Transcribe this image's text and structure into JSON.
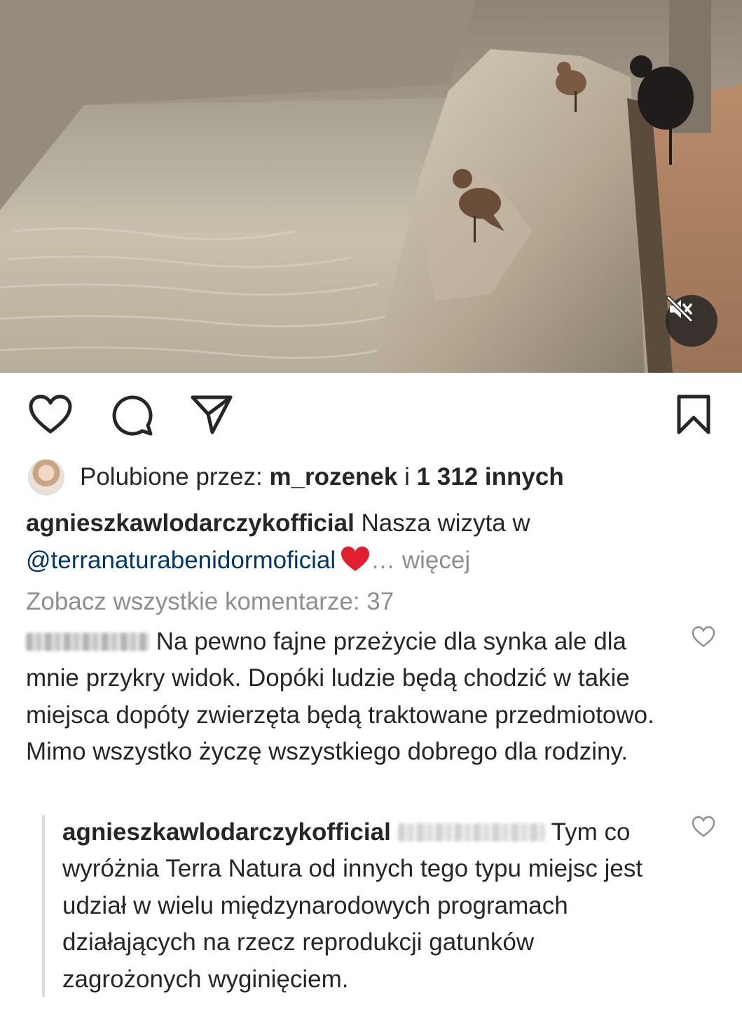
{
  "post": {
    "likes": {
      "prefix": "Polubione przez:",
      "user": "m_rozenek",
      "joiner": "i",
      "others": "1 312 innych"
    },
    "caption": {
      "username": "agnieszkawlodarczykofficial",
      "text": "Nasza wizyta w",
      "mention": "@terranaturabenidormoficial",
      "emoji": "heart-emoji",
      "more": "… więcej"
    },
    "view_all_comments": "Zobacz wszystkie komentarze: 37"
  },
  "comments": [
    {
      "username": "",
      "username_blurred": true,
      "text": "Na pewno fajne przeżycie dla synka ale dla mnie przykry widok. Dopóki ludzie będą chodzić w takie miejsca dopóty zwierzęta będą traktowane przedmiotowo. Mimo wszystko życzę wszystkiego dobrego dla rodziny.",
      "like_icon": "heart-outline-icon"
    },
    {
      "username": "agnieszkawlodarczykofficial",
      "mention_blurred": true,
      "text": "Tym co wyróżnia Terra Natura od innych tego typu miejsc jest udział w wielu międzynarodowych programach działających na rzecz reprodukcji gatunków zagrożonych wyginięciem.",
      "like_icon": "heart-outline-icon",
      "is_reply": true
    }
  ],
  "icons": {
    "like": "heart-outline-icon",
    "comment": "comment-bubble-icon",
    "share": "paper-plane-icon",
    "save": "bookmark-icon",
    "mute": "speaker-muted-icon"
  },
  "colors": {
    "text": "#262626",
    "secondary": "#8e8e8e",
    "mention": "#00376b",
    "heart_emoji": "#e0202f"
  }
}
